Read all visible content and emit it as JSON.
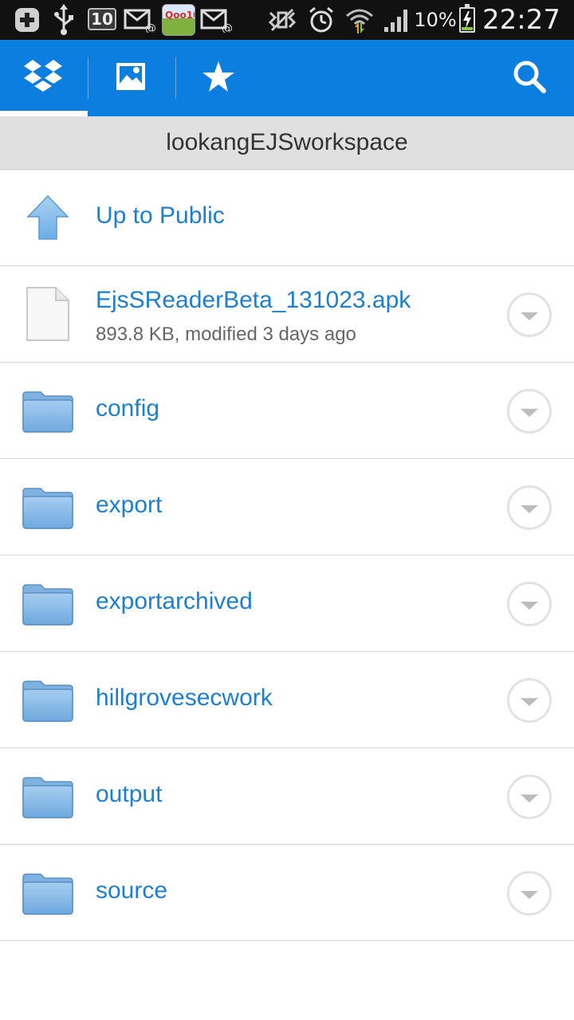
{
  "status_bar": {
    "notification_count": "10",
    "qoo_label": "Qoo10",
    "battery_percent": "10%",
    "time": "22:27"
  },
  "toolbar": {
    "tabs": [
      {
        "icon": "dropbox-icon",
        "selected": true
      },
      {
        "icon": "photos-icon",
        "selected": false
      },
      {
        "icon": "star-icon",
        "selected": false
      }
    ],
    "search_icon": "search-icon",
    "colors": {
      "bar": "#0b7ee0",
      "underline": "#ffffff"
    }
  },
  "path": {
    "title": "lookangEJSworkspace"
  },
  "list": {
    "up_item": {
      "label": "Up to Public"
    },
    "items": [
      {
        "type": "file",
        "name": "EjsSReaderBeta_131023.apk",
        "meta": "893.8 KB, modified 3 days ago"
      },
      {
        "type": "folder",
        "name": "config"
      },
      {
        "type": "folder",
        "name": "export"
      },
      {
        "type": "folder",
        "name": "exportarchived"
      },
      {
        "type": "folder",
        "name": "hillgrovesecwork"
      },
      {
        "type": "folder",
        "name": "output"
      },
      {
        "type": "folder",
        "name": "source"
      }
    ],
    "colors": {
      "title": "#1f7fcf",
      "meta": "#666666"
    }
  }
}
